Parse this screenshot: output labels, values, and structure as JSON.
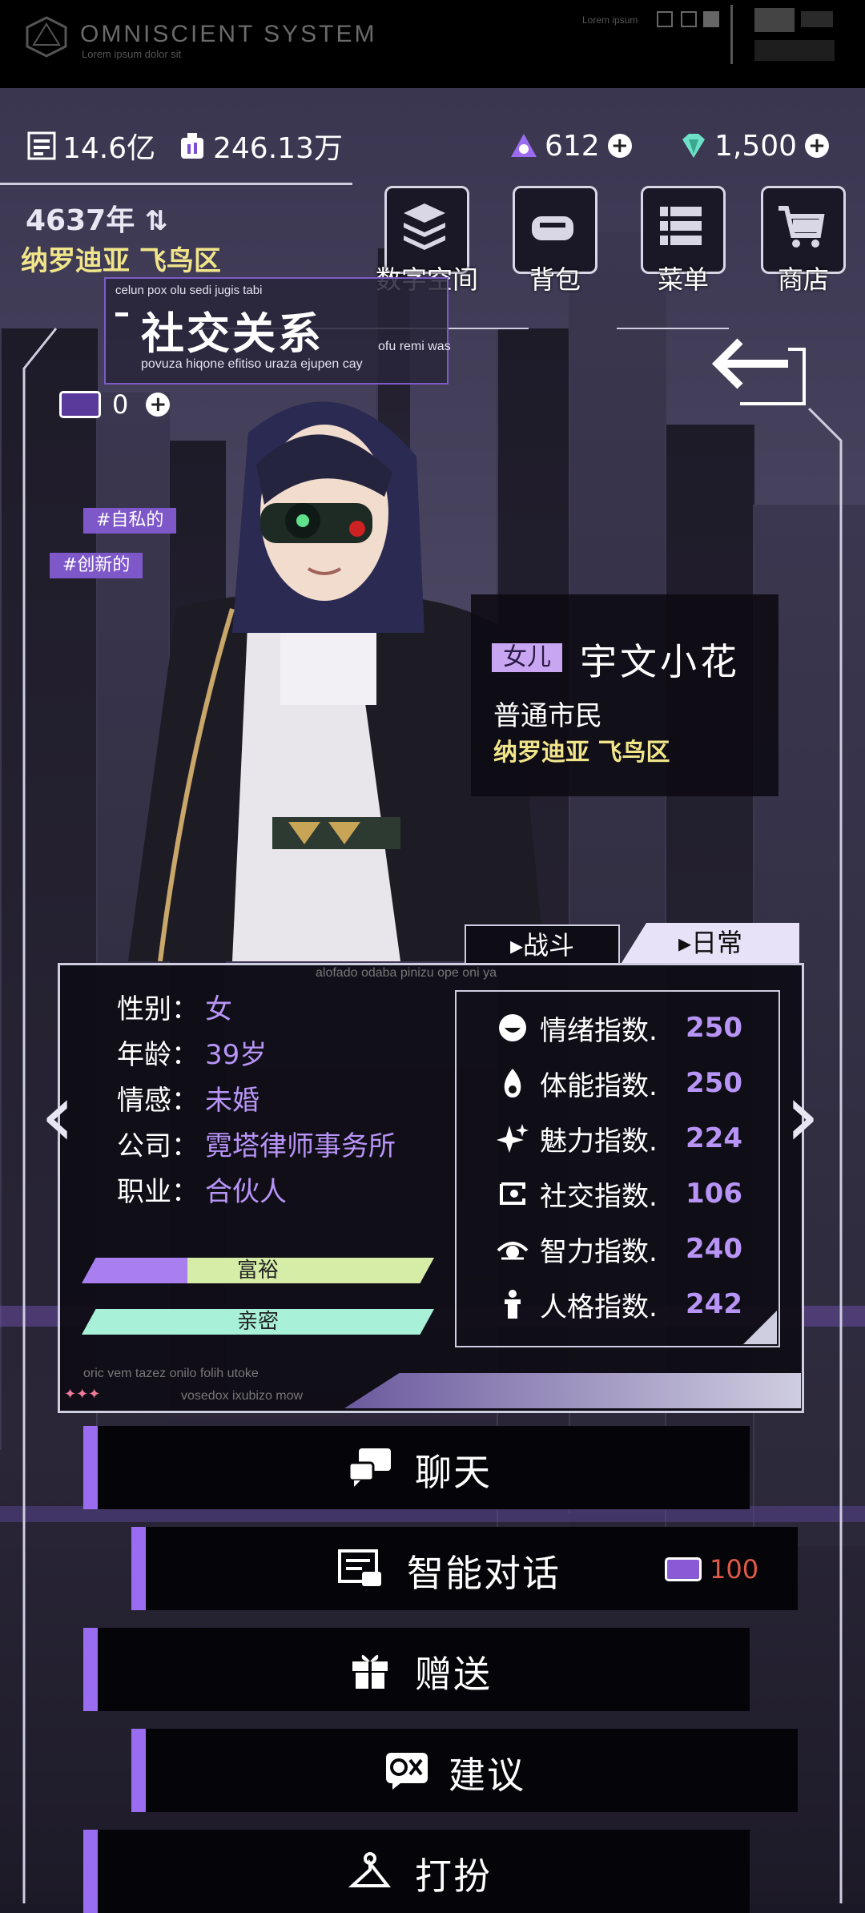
{
  "system": {
    "title": "OMNISCIENT  SYSTEM",
    "subtitle": "Lorem ipsum dolor sit",
    "corner_text": "Lorem ipsum"
  },
  "resources": {
    "coins": "14.6亿",
    "gems": "246.13万",
    "energy": "612",
    "diamonds": "1,500"
  },
  "world": {
    "year": "4637年",
    "location": "纳罗迪亚  飞鸟区"
  },
  "top_buttons": [
    {
      "label": "数字空间",
      "icon": "layers-icon"
    },
    {
      "label": "背包",
      "icon": "bag-icon"
    },
    {
      "label": "菜单",
      "icon": "menu-list-icon"
    },
    {
      "label": "商店",
      "icon": "shopping-cart-icon"
    }
  ],
  "page": {
    "title": "社交关系",
    "caption_top": "celun pox olu sedi jugis tabi",
    "caption_side": "ofu remi was",
    "caption_bottom": "povuza hiqone efitiso uraza ejupen cay"
  },
  "tickets": {
    "count": "0"
  },
  "tags": [
    "#自私的",
    "#创新的"
  ],
  "character": {
    "relation": "女儿",
    "name": "宇文小花",
    "class": "普通市民",
    "location": "纳罗迪亚  飞鸟区"
  },
  "tabs": {
    "battle": "战斗",
    "daily": "日常",
    "active": "日常"
  },
  "panel_caption": "alofado odaba pinizu ope oni ya",
  "profile": [
    {
      "label": "性别：",
      "value": "女"
    },
    {
      "label": "年龄：",
      "value": "39岁"
    },
    {
      "label": "情感：",
      "value": "未婚"
    },
    {
      "label": "公司：",
      "value": "霓塔律师事务所"
    },
    {
      "label": "职业：",
      "value": "合伙人"
    }
  ],
  "bars": [
    {
      "label": "富裕",
      "fill": 0.3,
      "fill_color": "#a97ff0",
      "rest_color": "#d6eda8"
    },
    {
      "label": "亲密",
      "fill": 1.0,
      "fill_color": "#a8f0d8",
      "rest_color": "#d6eda8"
    }
  ],
  "stats": [
    {
      "label": "情绪指数.",
      "value": "250",
      "icon": "smile-icon"
    },
    {
      "label": "体能指数.",
      "value": "250",
      "icon": "flame-icon"
    },
    {
      "label": "魅力指数.",
      "value": "224",
      "icon": "sparkle-icon"
    },
    {
      "label": "社交指数.",
      "value": "106",
      "icon": "social-icon"
    },
    {
      "label": "智力指数.",
      "value": "240",
      "icon": "eye-icon"
    },
    {
      "label": "人格指数.",
      "value": "242",
      "icon": "person-icon"
    }
  ],
  "panel_footer": {
    "line1": "oric vem tazez onilo folih utoke",
    "line2": "vosedox ixubizo mow"
  },
  "actions": [
    {
      "label": "聊天",
      "icon": "chat-icon"
    },
    {
      "label": "智能对话",
      "icon": "smart-dialog-icon",
      "cost": "100"
    },
    {
      "label": "赠送",
      "icon": "gift-icon"
    },
    {
      "label": "建议",
      "icon": "ox-icon"
    },
    {
      "label": "打扮",
      "icon": "hanger-icon"
    }
  ],
  "colors": {
    "accent": "#9a6df0",
    "gold": "#f1e58a",
    "stat_value": "#b794f6",
    "cost": "#e05a4a"
  }
}
